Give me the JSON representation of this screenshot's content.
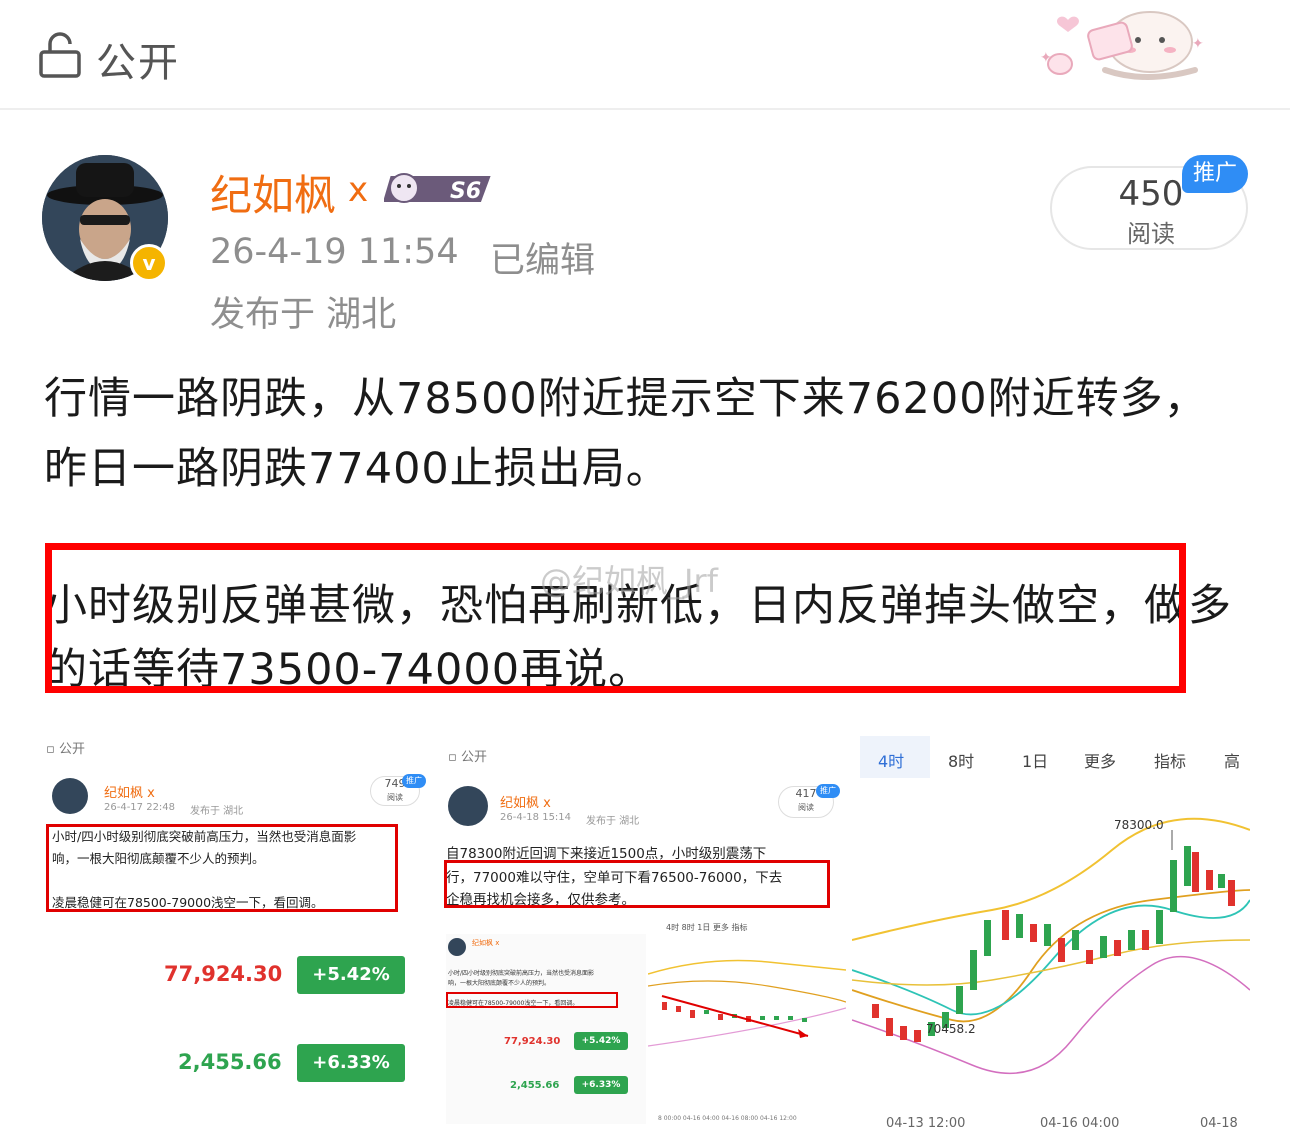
{
  "header": {
    "visibility_label": "公开",
    "icon": "lock-open-icon"
  },
  "post": {
    "author": "纪如枫",
    "author_suffix": "x",
    "badge_text": "S6",
    "timestamp": "26-4-19 11:54",
    "edited": "已编辑",
    "location": "发布于 湖北",
    "reads_count": "450",
    "reads_label": "阅读",
    "promo_label": "推广",
    "paragraph1": "行情一路阴跌，从78500附近提示空下来76200附近转多，昨日一路阴跌77400止损出局。",
    "paragraph2": "小时级别反弹甚微，恐怕再刷新低，日内反弹掉头做空，做多的话等待73500-74000再说。",
    "watermark": "@纪如枫_Jrf"
  },
  "thumbnails": [
    {
      "visibility": "公开",
      "author": "纪如枫 x",
      "timestamp": "26-4-17 22:48",
      "location": "发布于 湖北",
      "reads": "749",
      "reads_label": "阅读",
      "promo": "推广",
      "line1": "小时/四小时级别彻底突破前高压力，当然也受消息面影",
      "line2": "响，一根大阳彻底颠覆不少人的预判。",
      "line3": "凌晨稳健可在78500-79000浅空一下，看回调。",
      "price1": "77,924.30",
      "pct1": "+5.42%",
      "price2": "2,455.66",
      "pct2": "+6.33%"
    },
    {
      "visibility": "公开",
      "author": "纪如枫 x",
      "timestamp": "26-4-18 15:14",
      "location": "发布于 湖北",
      "reads": "417",
      "reads_label": "阅读",
      "promo": "推广",
      "line1": "自78300附近回调下来接近1500点，小时级别震荡下",
      "line2": "行，77000难以守住，空单可下看76500-76000，下去",
      "line3": "企稳再找机会接多，仅供参考。",
      "price1": "77,924.30",
      "pct1": "+5.42%",
      "price2": "2,455.66",
      "pct2": "+6.33%",
      "mini_tabs": [
        "4时",
        "8时",
        "1日",
        "更多",
        "指标"
      ]
    },
    {
      "tabs": [
        "4时",
        "8时",
        "1日",
        "更多",
        "指标",
        "高"
      ],
      "high_label": "78300.0",
      "low_label": "70458.2",
      "x_labels": [
        "04-13 12:00",
        "04-16 04:00",
        "04-18"
      ]
    }
  ],
  "colors": {
    "author": "#f06d12",
    "promo": "#2f8df5",
    "highlight_border": "#ff0000",
    "up_green": "#2ea44f",
    "price_red": "#e0322d"
  }
}
